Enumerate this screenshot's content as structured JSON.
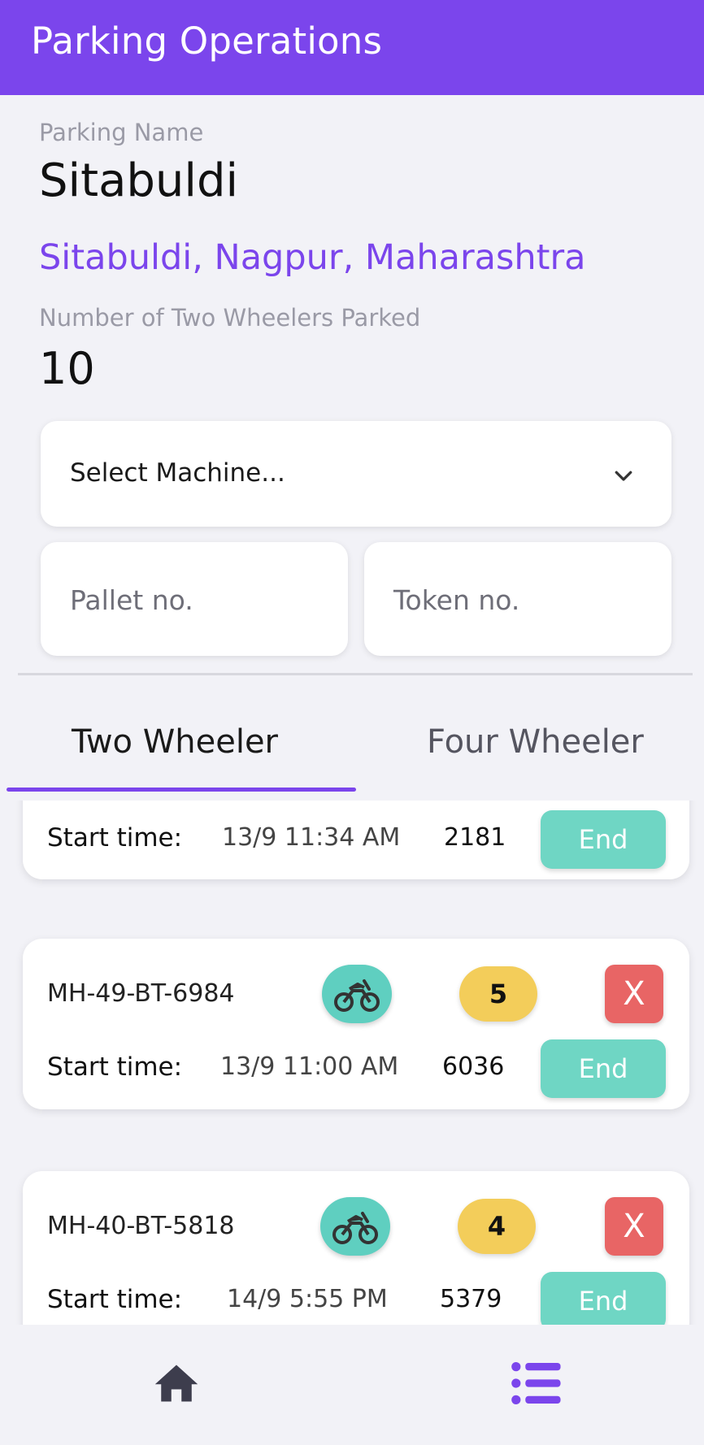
{
  "app_bar": {
    "title": "Parking Operations"
  },
  "parking": {
    "name_label": "Parking Name",
    "name": "Sitabuldi",
    "address": "Sitabuldi, Nagpur, Maharashtra",
    "count_label": "Number of Two Wheelers Parked",
    "count": "10"
  },
  "form": {
    "machine_select": "Select Machine...",
    "pallet_placeholder": "Pallet no.",
    "token_placeholder": "Token no."
  },
  "tabs": [
    {
      "label": "Two Wheeler",
      "selected": true
    },
    {
      "label": "Four Wheeler",
      "selected": false
    }
  ],
  "records": [
    {
      "start_label": "Start time:",
      "start_time": "13/9 11:34 AM",
      "token": "2181",
      "end_label": "End"
    },
    {
      "plate": "MH-49-BT-6984",
      "pallet": "5",
      "cancel_label": "X",
      "start_label": "Start time:",
      "start_time": "13/9 11:00 AM",
      "token": "6036",
      "end_label": "End"
    },
    {
      "plate": "MH-40-BT-5818",
      "pallet": "4",
      "cancel_label": "X",
      "start_label": "Start time:",
      "start_time": "14/9 5:55 PM",
      "token": "5379",
      "end_label": "End"
    }
  ],
  "nav": {
    "items": [
      "home-icon",
      "list-icon"
    ],
    "active": "list-icon"
  },
  "colors": {
    "primary": "#7b45ec",
    "teal": "#6fd6c4",
    "yellow": "#f3cd5a",
    "red": "#e86565"
  }
}
